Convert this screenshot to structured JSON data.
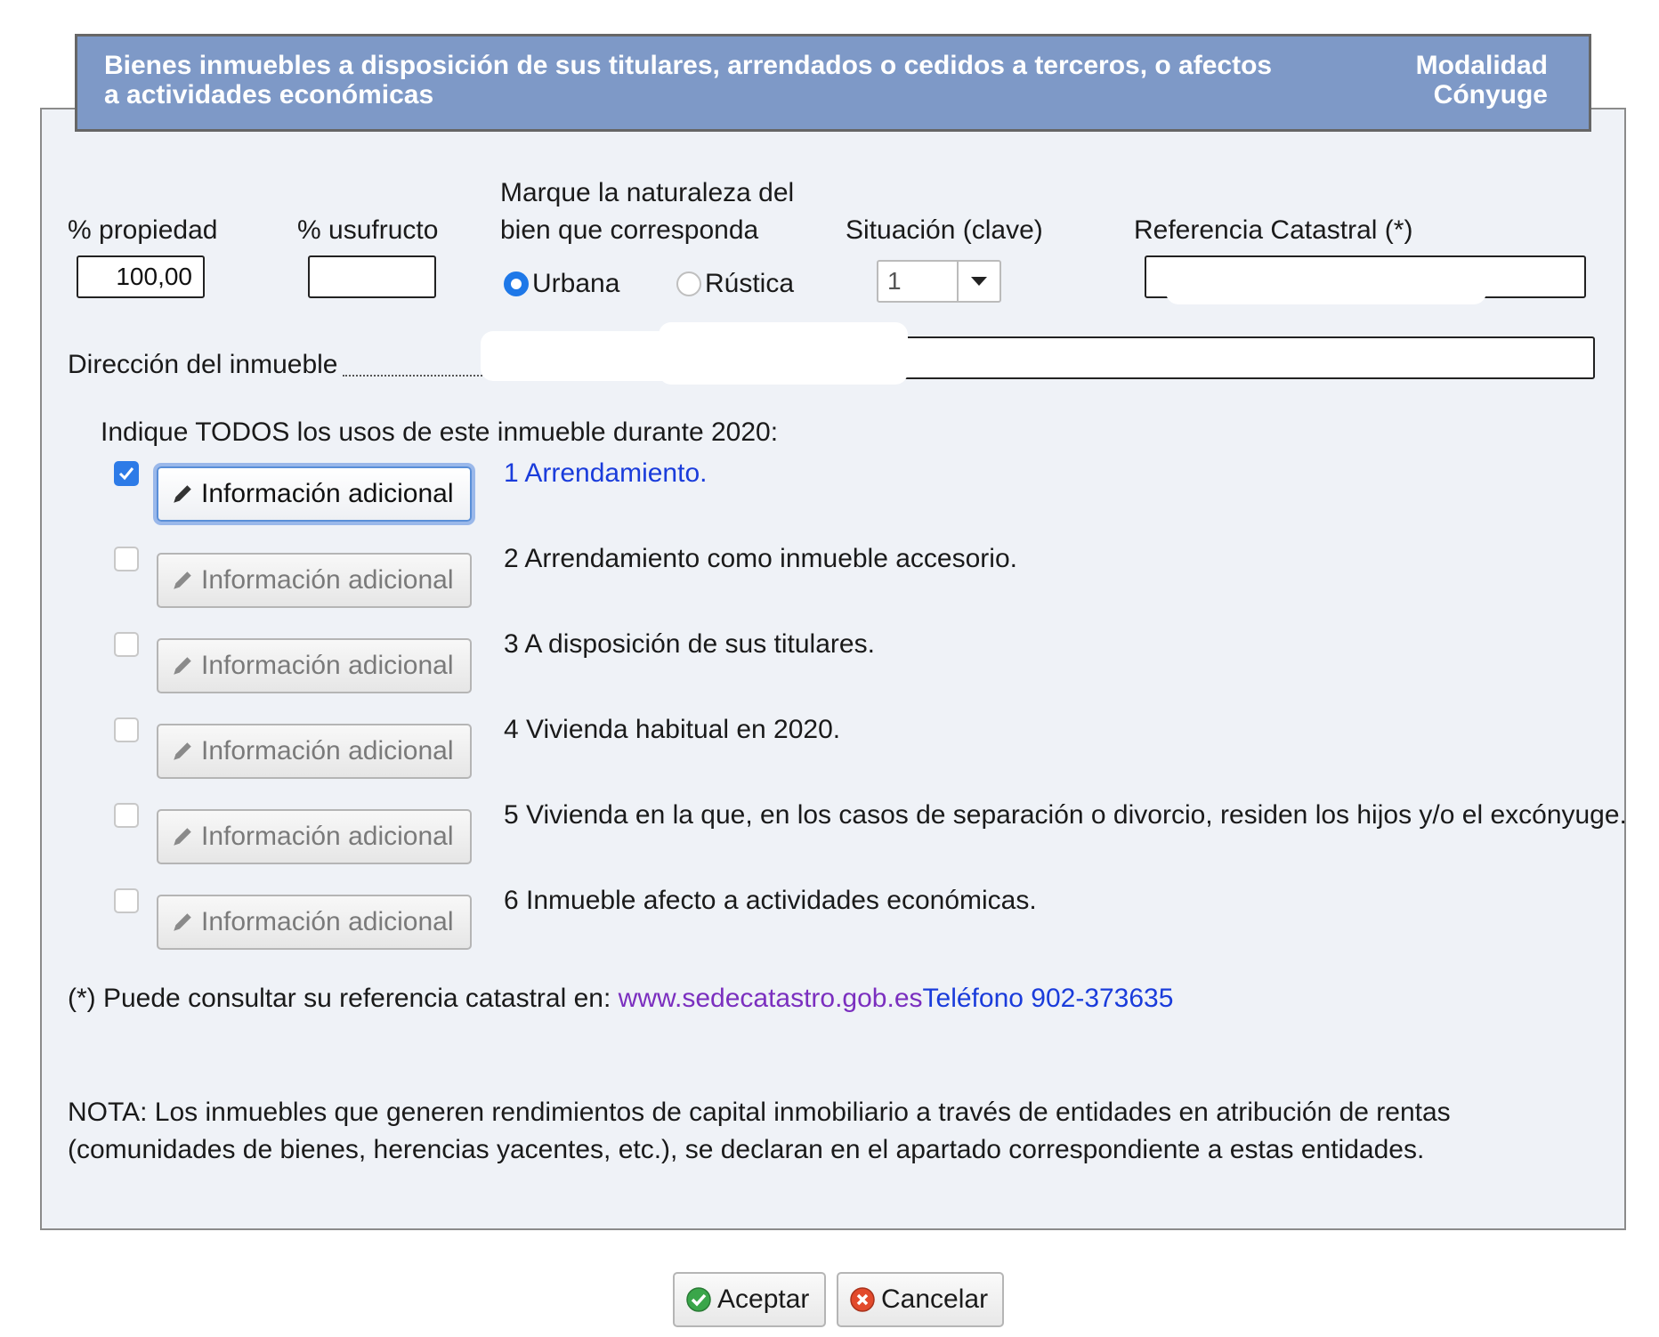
{
  "header": {
    "title": "Bienes inmuebles a disposición de sus titulares, arrendados o cedidos a terceros, o afectos a actividades económicas",
    "modalidad_label": "Modalidad",
    "modalidad_value": "Cónyuge"
  },
  "fields": {
    "propiedad_label": "% propiedad",
    "propiedad_value": "100,00",
    "usufructo_label": "% usufructo",
    "usufructo_value": "",
    "naturaleza_label_1": "Marque la naturaleza del",
    "naturaleza_label_2": "bien que corresponda",
    "naturaleza_options": [
      "Urbana",
      "Rústica"
    ],
    "naturaleza_selected": "Urbana",
    "situacion_label": "Situación (clave)",
    "situacion_value": "1",
    "referencia_label": "Referencia Catastral (*)",
    "referencia_value": "",
    "direccion_label": "Dirección del inmueble",
    "direccion_value": ""
  },
  "usos": {
    "heading": "Indique TODOS los usos de este inmueble durante 2020:",
    "button_label": "Información adicional",
    "items": [
      {
        "label": "1 Arrendamiento.",
        "checked": true
      },
      {
        "label": "2 Arrendamiento como inmueble accesorio.",
        "checked": false
      },
      {
        "label": "3 A disposición de sus titulares.",
        "checked": false
      },
      {
        "label": "4 Vivienda habitual en 2020.",
        "checked": false
      },
      {
        "label": "5 Vivienda en la que, en los casos de separación o divorcio, residen los hijos y/o el excónyuge.",
        "checked": false
      },
      {
        "label": "6 Inmueble afecto a actividades económicas.",
        "checked": false
      }
    ]
  },
  "footnote": {
    "text": "(*) Puede consultar su referencia catastral en: ",
    "link": "www.sedecatastro.gob.es",
    "phone": "Teléfono 902-373635"
  },
  "nota": {
    "line1": "NOTA: Los inmuebles que generen rendimientos de capital inmobiliario a través de entidades en atribución de rentas",
    "line2": "(comunidades de bienes, herencias yacentes, etc.), se declaran en el apartado correspondiente a estas entidades."
  },
  "actions": {
    "accept": "Aceptar",
    "cancel": "Cancelar"
  },
  "colors": {
    "header_bg": "#7e99c7",
    "panel_bg": "#eff2f7",
    "link_blue": "#1a3cdb",
    "link_visited": "#7b2fbf",
    "checkbox_blue": "#2d7be7"
  }
}
